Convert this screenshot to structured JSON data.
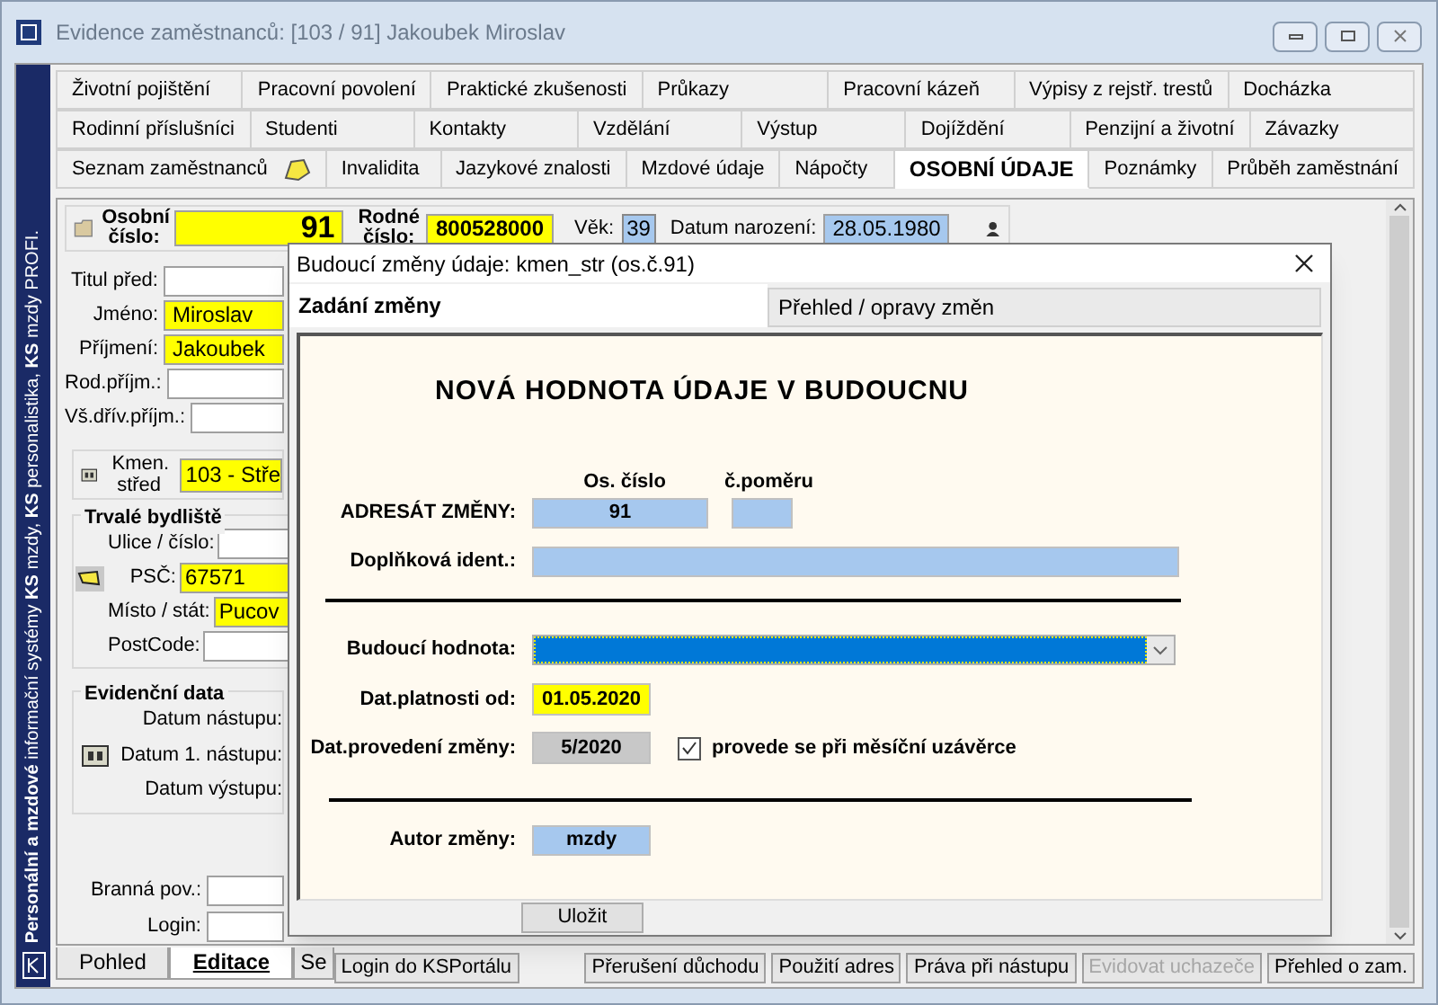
{
  "window": {
    "title": "Evidence zaměstnanců: [103 / 91] Jakoubek Miroslav",
    "side_text": "**Personální a mzdové** informační systémy **KS** mzdy, **KS** personalistika, **KS** mzdy PROFI."
  },
  "tabs": [
    [
      {
        "label": "Životní pojištění",
        "selected": false
      },
      {
        "label": "Pracovní povolení",
        "selected": false
      },
      {
        "label": "Praktické zkušenosti",
        "selected": false
      },
      {
        "label": "Průkazy",
        "selected": false
      },
      {
        "label": "Pracovní kázeň",
        "selected": false
      },
      {
        "label": "Výpisy z rejstř. trestů",
        "selected": false
      },
      {
        "label": "Docházka",
        "selected": false
      }
    ],
    [
      {
        "label": "Rodinní příslušníci",
        "selected": false
      },
      {
        "label": "Studenti",
        "selected": false
      },
      {
        "label": "Kontakty",
        "selected": false
      },
      {
        "label": "Vzdělání",
        "selected": false
      },
      {
        "label": "Výstup",
        "selected": false
      },
      {
        "label": "Dojíždění",
        "selected": false
      },
      {
        "label": "Penzijní a životní",
        "selected": false
      },
      {
        "label": "Závazky",
        "selected": false
      }
    ],
    [
      {
        "label": "Seznam zaměstnanců",
        "selected": false,
        "kind": "icon"
      },
      {
        "label": "Invalidita",
        "selected": false
      },
      {
        "label": "Jazykové znalosti",
        "selected": false
      },
      {
        "label": "Mzdové údaje",
        "selected": false
      },
      {
        "label": "Nápočty",
        "selected": false
      },
      {
        "label": "OSOBNÍ ÚDAJE",
        "selected": true
      },
      {
        "label": "Poznámky",
        "selected": false
      },
      {
        "label": "Průběh zaměstnání",
        "selected": false
      }
    ]
  ],
  "header": {
    "personal_number": {
      "label": "Osobní číslo:",
      "value": "91"
    },
    "birth_number": {
      "label": "Rodné číslo:",
      "value": "800528000"
    },
    "age": {
      "label": "Věk:",
      "value": "39"
    },
    "birth_date": {
      "label": "Datum narození:",
      "value": "28.05.1980"
    }
  },
  "personal": [
    {
      "label": "Titul před:",
      "highlighted": false
    },
    {
      "label": "Jméno:",
      "value": "Miroslav",
      "highlighted": true
    },
    {
      "label": "Příjmení:",
      "value": "Jakoubek",
      "highlighted": true
    },
    {
      "label": "Rod.příjm.:",
      "highlighted": false
    },
    {
      "label": "Vš.dřív.příjm.:",
      "highlighted": false
    }
  ],
  "cost_center": {
    "label": "Kmen. střed",
    "value": "103 - Stře"
  },
  "address": {
    "title": "Trvalé bydliště",
    "fields": [
      {
        "label": "Ulice / číslo:",
        "highlighted": false
      },
      {
        "label": "PSČ:",
        "value": "67571",
        "highlighted": true,
        "kind": "icon"
      },
      {
        "label": "Místo / stát:",
        "value": "Pucov",
        "highlighted": true
      },
      {
        "label": "PostCode:",
        "highlighted": false
      }
    ]
  },
  "records": {
    "title": "Evidenční data",
    "fields": [
      {
        "label": "Datum nástupu:"
      },
      {
        "label": "Datum 1. nástupu:",
        "kind": "icon"
      },
      {
        "label": "Datum výstupu:"
      }
    ]
  },
  "extra": [
    {
      "label": "Branná pov.:"
    },
    {
      "label": "Login:"
    }
  ],
  "bottom_tabs": [
    {
      "label": "Pohled",
      "selected": false
    },
    {
      "label": "Editace",
      "selected": true
    },
    {
      "label": "Se",
      "selected": false
    }
  ],
  "bottom_buttons": [
    {
      "label": "Login do KSPortálu",
      "disabled": false
    },
    {
      "label": "Přerušení důchodu",
      "disabled": false
    },
    {
      "label": "Použití adres",
      "disabled": false
    },
    {
      "label": "Práva při nástupu",
      "disabled": false
    },
    {
      "label": "Evidovat uchazeče",
      "disabled": true
    },
    {
      "label": "Přehled o zam.",
      "disabled": false
    }
  ],
  "dialog": {
    "title": "Budoucí změny údaje: kmen_str (os.č.91)",
    "tabs": [
      {
        "label": "Zadání změny",
        "selected": true
      },
      {
        "label": "Přehled / opravy změn",
        "selected": false
      }
    ],
    "heading": "NOVÁ HODNOTA ÚDAJE V BUDOUCNU",
    "columns": [
      "Os. číslo",
      "č.poměru"
    ],
    "addressee": {
      "label": "ADRESÁT ZMĚNY:",
      "number": "91"
    },
    "extra_ident": {
      "label": "Doplňková ident.:"
    },
    "future_value": {
      "label": "Budoucí hodnota:"
    },
    "valid_from": {
      "label": "Dat.platnosti od:",
      "value": "01.05.2020"
    },
    "executed": {
      "label": "Dat.provedení změny:",
      "value": "5/2020",
      "checkbox_label": "provede se při měsíční uzávěrce",
      "checked": true
    },
    "author": {
      "label": "Autor změny:",
      "value": "mzdy"
    },
    "save_button": "Uložit"
  }
}
